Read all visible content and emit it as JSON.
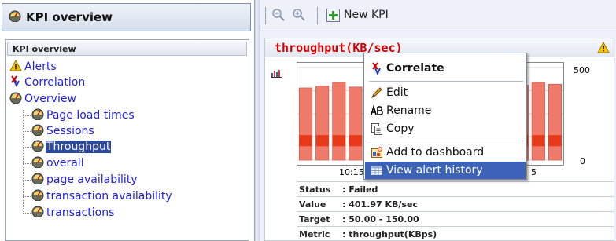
{
  "left_panel": {
    "header_title": "KPI overview",
    "tree_header": "KPI overview",
    "tree_items": [
      {
        "label": "Alerts",
        "icon": "warning-icon"
      },
      {
        "label": "Correlation",
        "icon": "correlation-icon"
      },
      {
        "label": "Overview",
        "icon": "gauge-icon"
      },
      {
        "label": "Page load times",
        "icon": "gauge-icon"
      },
      {
        "label": "Sessions",
        "icon": "gauge-icon"
      },
      {
        "label": "Throughput",
        "icon": "gauge-icon",
        "selected": true
      },
      {
        "label": "overall",
        "icon": "gauge-icon"
      },
      {
        "label": "page availability",
        "icon": "gauge-icon"
      },
      {
        "label": "transaction availability",
        "icon": "gauge-icon"
      },
      {
        "label": "transactions",
        "icon": "gauge-icon"
      }
    ]
  },
  "toolbar": {
    "zoom_out_icon": "zoom-out-icon",
    "zoom_in_icon": "zoom-in-icon",
    "new_kpi_label": "New KPI"
  },
  "kpi_card": {
    "title": "throughput(KB/sec)",
    "warning_icon": "warning-icon",
    "y_max_label": "500",
    "y_min_label": "0",
    "x_tick_label": "10:15",
    "x_tick_label_2": "5",
    "details": [
      {
        "key": "Status",
        "value": ": Failed"
      },
      {
        "key": "Value",
        "value": ": 401.97 KB/sec"
      },
      {
        "key": "Target",
        "value": ": 50.00 - 150.00"
      },
      {
        "key": "Metric",
        "value": ": throughput(KBps)"
      }
    ]
  },
  "context_menu": {
    "items": [
      {
        "label": "Correlate",
        "icon": "correlate-icon",
        "bold": true
      },
      {
        "label": "Edit",
        "icon": "pencil-icon"
      },
      {
        "label": "Rename",
        "icon": "rename-icon"
      },
      {
        "label": "Copy",
        "icon": "copy-icon"
      },
      {
        "label": "Add to dashboard",
        "icon": "add-dashboard-icon"
      },
      {
        "label": "View alert history",
        "icon": "table-icon",
        "highlighted": true
      }
    ]
  },
  "chart_data": {
    "type": "bar",
    "bar_color": "#f07a6a",
    "alert_band_color": "#e83a1a",
    "ylim": [
      0,
      500
    ],
    "values": [
      390,
      400,
      420,
      395,
      410,
      430,
      400,
      415,
      405,
      420,
      400,
      410,
      395,
      405,
      420,
      410
    ]
  },
  "colors": {
    "accent": "#3c63b8",
    "title_red": "#d40000",
    "link_blue": "#2020e0"
  }
}
